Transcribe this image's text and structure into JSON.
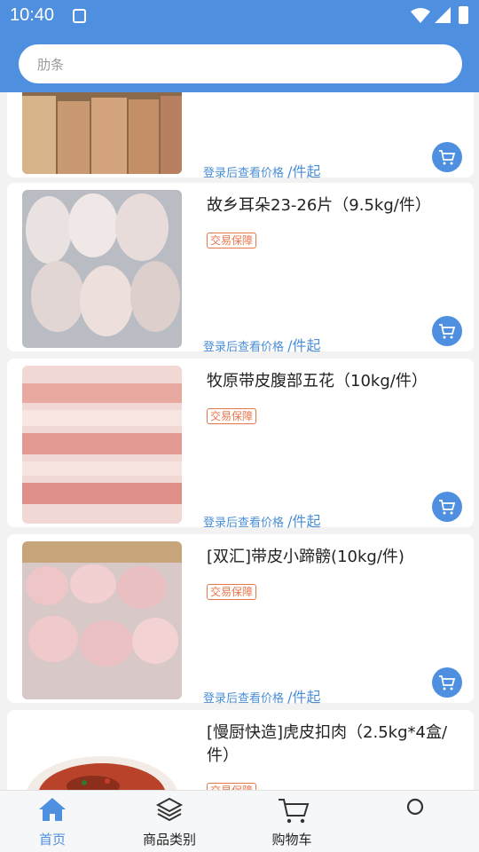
{
  "status_bar": {
    "time": "10:40"
  },
  "search": {
    "placeholder": "肋条"
  },
  "products": [
    {
      "title": "",
      "badge": "",
      "price_text": "登录后查看价格",
      "price_unit": "/件起"
    },
    {
      "title": "故乡耳朵23-26片（9.5kg/件）",
      "badge": "交易保障",
      "price_text": "登录后查看价格",
      "price_unit": "/件起"
    },
    {
      "title": "牧原带皮腹部五花（10kg/件）",
      "badge": "交易保障",
      "price_text": "登录后查看价格",
      "price_unit": "/件起"
    },
    {
      "title": "[双汇]带皮小蹄髈(10kg/件)",
      "badge": "交易保障",
      "price_text": "登录后查看价格",
      "price_unit": "/件起"
    },
    {
      "title": "[慢厨快造]虎皮扣肉（2.5kg*4盒/件）",
      "badge": "交易保障",
      "price_text": "",
      "price_unit": ""
    }
  ],
  "bottom_nav": [
    {
      "label": "首页",
      "icon": "home-icon",
      "active": true
    },
    {
      "label": "商品类别",
      "icon": "layers-icon",
      "active": false
    },
    {
      "label": "购物车",
      "icon": "cart-icon",
      "active": false
    },
    {
      "label": "",
      "icon": "profile-icon",
      "active": false
    }
  ],
  "colors": {
    "primary": "#4f8fe0",
    "badge": "#e8764c",
    "price": "#4a8ed6"
  }
}
